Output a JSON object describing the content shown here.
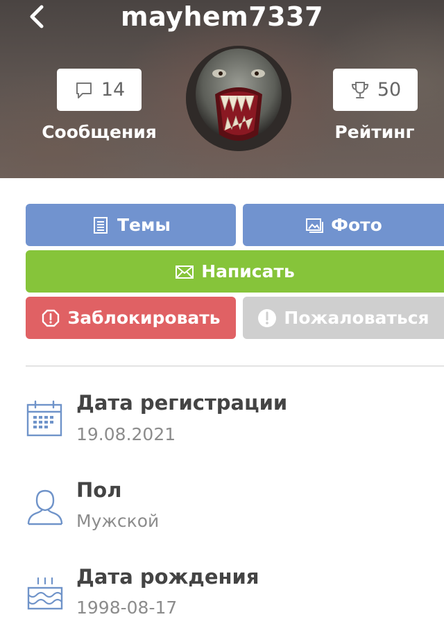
{
  "header": {
    "username": "mayhem7337",
    "messages_count": "14",
    "messages_label": "Сообщения",
    "rating_value": "50",
    "rating_label": "Рейтинг",
    "icons": [
      "back-arrow-icon",
      "speech-bubble-icon",
      "trophy-icon"
    ]
  },
  "actions": {
    "topics_label": "Темы",
    "photo_label": "Фото",
    "write_label": "Написать",
    "block_label": "Заблокировать",
    "report_label": "Пожаловаться",
    "icons": [
      "document-icon",
      "image-icon",
      "envelope-icon",
      "alert-octagon-icon",
      "exclamation-circle-icon"
    ]
  },
  "info": [
    {
      "title": "Дата регистрации",
      "value": "19.08.2021",
      "icon": "calendar-icon"
    },
    {
      "title": "Пол",
      "value": "Мужской",
      "icon": "user-icon"
    },
    {
      "title": "Дата рождения",
      "value": "1998-08-17",
      "icon": "birthday-cake-icon"
    }
  ],
  "colors": {
    "blue": "#7193cf",
    "green": "#86c43a",
    "red": "#e06164",
    "grey": "#cfcfcf",
    "icon_blue": "#6f93c9"
  }
}
